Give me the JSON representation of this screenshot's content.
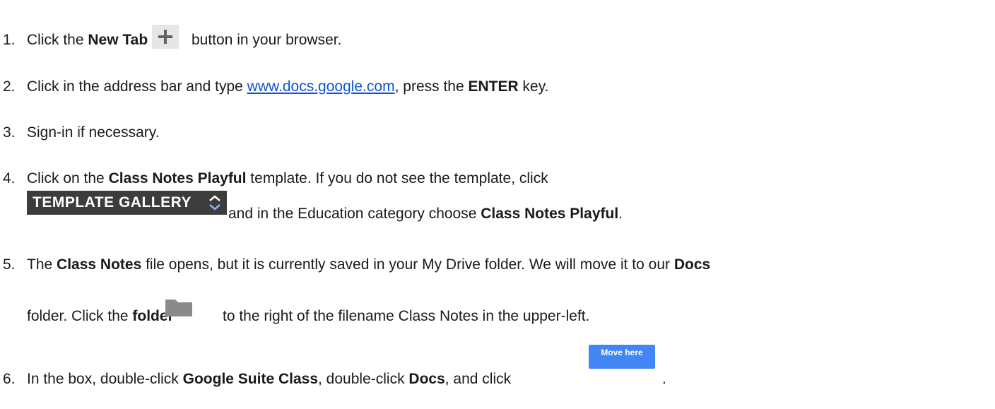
{
  "steps": [
    {
      "num": "1.",
      "pre": "Click the ",
      "bold1": "New Tab",
      "post": " button in your browser."
    },
    {
      "num": "2.",
      "pre": "Click in the address bar and type ",
      "link": "www.docs.google.com",
      "mid": ", press the ",
      "bold1": "ENTER",
      "post": " key."
    },
    {
      "num": "3.",
      "pre": "Sign-in if necessary."
    },
    {
      "num": "4.",
      "pre": "Click on the ",
      "bold1": "Class Notes Playful",
      "post": " template. If you do not see the template, click",
      "after_button": "and in the Education category choose ",
      "bold2": "Class Notes Playful",
      "end": "."
    },
    {
      "num": "5.",
      "pre": "The ",
      "bold1": "Class Notes",
      "mid": " file opens, but it is currently saved in your My Drive folder. We will move it to our ",
      "bold2": "Docs",
      "line2_pre": "folder. Click the ",
      "line2_bold": "folder",
      "line2_post": "to the right of the filename Class Notes in the upper-left."
    },
    {
      "num": "6.",
      "pre": "In the box, double-click ",
      "bold1": "Google Suite Class",
      "mid": ", double-click ",
      "bold2": "Docs",
      "post": ", and click",
      "end": "."
    }
  ],
  "buttons": {
    "template_gallery": "TEMPLATE GALLERY",
    "move_here": "Move here"
  },
  "icons": {
    "new_tab": "plus-icon",
    "template_gallery_toggle": "chevron-up-down-icon",
    "folder": "folder-icon"
  },
  "colors": {
    "link": "#1155cc",
    "template_gallery_bg": "#3c3c3c",
    "move_here_bg": "#4285f4"
  }
}
